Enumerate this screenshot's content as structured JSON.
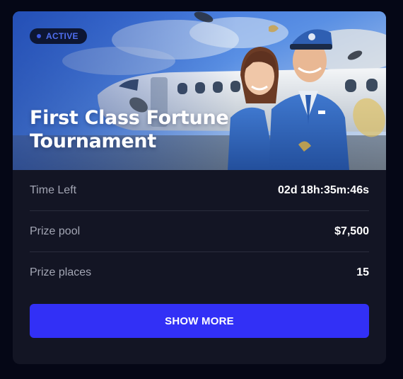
{
  "tournament": {
    "status": "ACTIVE",
    "title": "First Class Fortune Tournament",
    "image_description": "flight attendant and pilot in blue uniforms in front of a private jet",
    "details": [
      {
        "label": "Time Left",
        "value": "02d 18h:35m:46s"
      },
      {
        "label": "Prize pool",
        "value": "$7,500"
      },
      {
        "label": "Prize places",
        "value": "15"
      }
    ],
    "button_label": "SHOW MORE"
  },
  "colors": {
    "page_background": "#050716",
    "card_background": "#131524",
    "accent_button": "#3230f6",
    "badge_background": "#0d1633",
    "badge_text": "#4f6ff0",
    "label_text": "#a3a6b4",
    "value_text": "#ffffff"
  }
}
